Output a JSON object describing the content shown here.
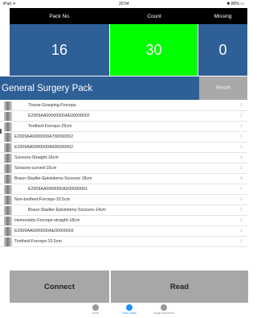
{
  "status_bar": {
    "carrier": "iPad ᯤ",
    "time": "20:54",
    "battery": "✱ 80% ▭"
  },
  "counters": {
    "headers": {
      "pack": "Pack No.",
      "count": "Count",
      "missing": "Missing"
    },
    "values": {
      "pack": "16",
      "count": "30",
      "missing": "0"
    },
    "colors": {
      "panel": "#2e5f96",
      "count_ok": "#00ff00"
    }
  },
  "title_bar": {
    "title": "General Surgery Pack",
    "reset_label": "Reset"
  },
  "items": [
    {
      "label": "Tissue-Grasping-Forceps",
      "qty": "1",
      "thumb": true,
      "indent": true
    },
    {
      "label": "E2009AA00000000AE00000002",
      "qty": "1",
      "thumb": true,
      "indent": true
    },
    {
      "label": "Toothed-Forceps-25cm",
      "qty": "1",
      "thumb": true,
      "indent": true
    },
    {
      "label": "E2009AA0000000A700000002",
      "qty": "1",
      "thumb": true,
      "indent": false
    },
    {
      "label": "E2009AA0000000A600000002",
      "qty": "1",
      "thumb": true,
      "indent": false
    },
    {
      "label": "Scissors-Straight-16cm",
      "qty": "4",
      "thumb": true,
      "indent": false
    },
    {
      "label": "Scissors-curved-15cm",
      "qty": "2",
      "thumb": true,
      "indent": false
    },
    {
      "label": "Braun-Stadler-Episiotomy-Scissors 18cm",
      "qty": "4",
      "thumb": true,
      "indent": false
    },
    {
      "label": "E2009AA0000000AD00000001",
      "qty": "1",
      "thumb": true,
      "indent": true
    },
    {
      "label": "Non-toothed-Forceps-15.5cm",
      "qty": "2",
      "thumb": true,
      "indent": false
    },
    {
      "label": "Braun-Stadler-Episiotomy-Scissors-14cm",
      "qty": "2",
      "thumb": true,
      "indent": true
    },
    {
      "label": "Hemostatic-Forceps-straight-18cm",
      "qty": "1",
      "thumb": true,
      "indent": false
    },
    {
      "label": "E2009AA0000000AE00000003",
      "qty": "1",
      "thumb": true,
      "indent": false
    },
    {
      "label": "Toothed-Forceps-15.5cm",
      "qty": "1",
      "thumb": true,
      "indent": false
    }
  ],
  "footer": {
    "connect_label": "Connect",
    "read_label": "Read"
  },
  "tabbar": {
    "tabs": [
      {
        "label": "Home",
        "icon": "home-icon"
      },
      {
        "label": "Pack Check",
        "icon": "pack-check-icon"
      },
      {
        "label": "Single Instrument",
        "icon": "single-instrument-icon"
      }
    ]
  }
}
